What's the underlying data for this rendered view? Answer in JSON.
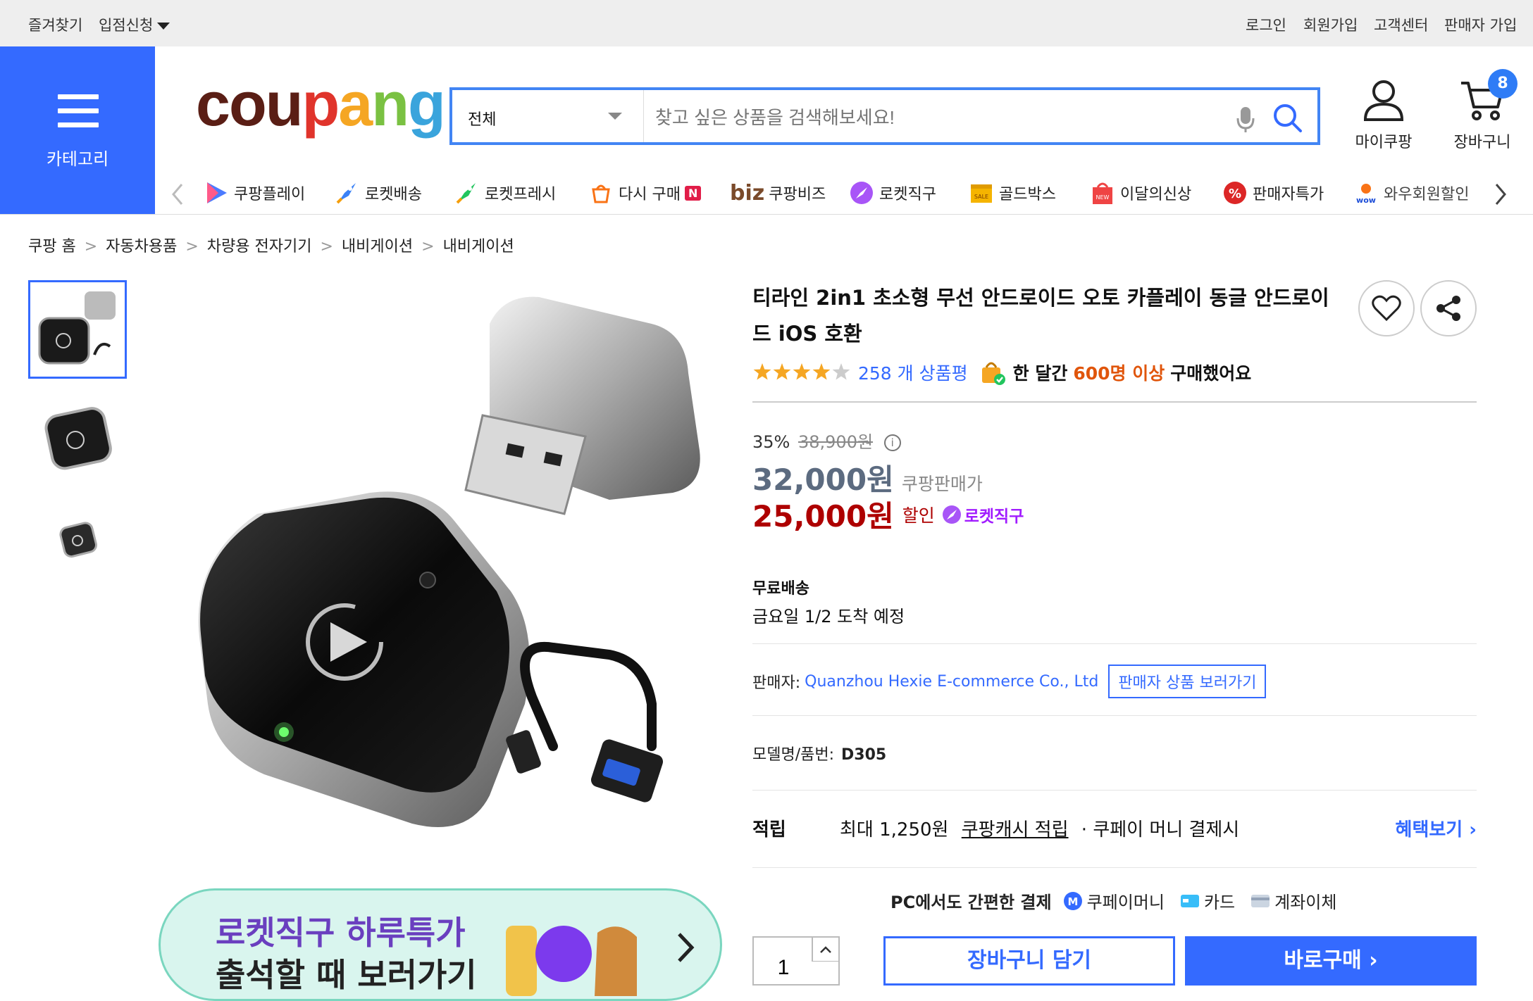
{
  "topbar": {
    "favorites": "즐겨찾기",
    "seller_apply": "입점신청",
    "login": "로그인",
    "signup": "회원가입",
    "customer_center": "고객센터",
    "seller_signup": "판매자 가입"
  },
  "header": {
    "category_label": "카테고리",
    "logo": "coupang",
    "search_category": "전체",
    "search_placeholder": "찾고 싶은 상품을 검색해보세요!",
    "my_coupang": "마이쿠팡",
    "cart": "장바구니",
    "cart_count": "8"
  },
  "nav": [
    {
      "label": "쿠팡플레이",
      "icon": "play-icon"
    },
    {
      "label": "로켓배송",
      "icon": "rocket-icon"
    },
    {
      "label": "로켓프레시",
      "icon": "rocket-fresh-icon"
    },
    {
      "label": "다시 구매",
      "icon": "rebuy-icon",
      "badge": "N"
    },
    {
      "label": "쿠팡비즈",
      "icon": "biz-icon",
      "prefix": "biz"
    },
    {
      "label": "로켓직구",
      "icon": "rocket-global-icon"
    },
    {
      "label": "골드박스",
      "icon": "goldbox-icon"
    },
    {
      "label": "이달의신상",
      "icon": "new-bag-icon"
    },
    {
      "label": "판매자특가",
      "icon": "percent-icon"
    },
    {
      "label": "와우회원할인",
      "icon": "wow-icon"
    }
  ],
  "breadcrumb": [
    "쿠팡 홈",
    "자동차용품",
    "차량용 전자기기",
    "내비게이션",
    "내비게이션"
  ],
  "banner": {
    "line1": "로켓직구 하루특가",
    "line2": "출석할 때 보러가기"
  },
  "product": {
    "title": "티라인 2in1 초소형 무선 안드로이드 오토 카플레이 동글 안드로이드 iOS 호환",
    "rating": 4,
    "review_count": "258 개 상품평",
    "monthly_prefix": "한 달간",
    "monthly_highlight": "600명 이상",
    "monthly_suffix": "구매했어요",
    "discount_rate": "35%",
    "original_price": "38,900원",
    "sale_price": "32,000원",
    "sale_price_label": "쿠팡판매가",
    "final_price": "25,000원",
    "final_label": "할인",
    "rocket_label": "로켓직구",
    "shipping": "무료배송",
    "arrival": "금요일 1/2 도착 예정",
    "seller_label": "판매자:",
    "seller_name": "Quanzhou Hexie E-commerce Co., Ltd",
    "seller_button": "판매자 상품 보러가기",
    "model_label": "모델명/품번:",
    "model_value": "D305",
    "reward_label": "적립",
    "reward_text": "최대 1,250원",
    "reward_link": "쿠팡캐시 적립",
    "reward_suffix": "· 쿠페이 머니 결제시",
    "reward_more": "혜택보기",
    "pay_title": "PC에서도 간편한 결제",
    "pay_methods": [
      "쿠페이머니",
      "카드",
      "계좌이체"
    ],
    "quantity": "1",
    "cart_button": "장바구니 담기",
    "buy_button": "바로구매"
  },
  "colors": {
    "accent": "#346aff",
    "price_red": "#ae0000",
    "rocket_purple": "#a11cff",
    "star": "#f5a623"
  }
}
